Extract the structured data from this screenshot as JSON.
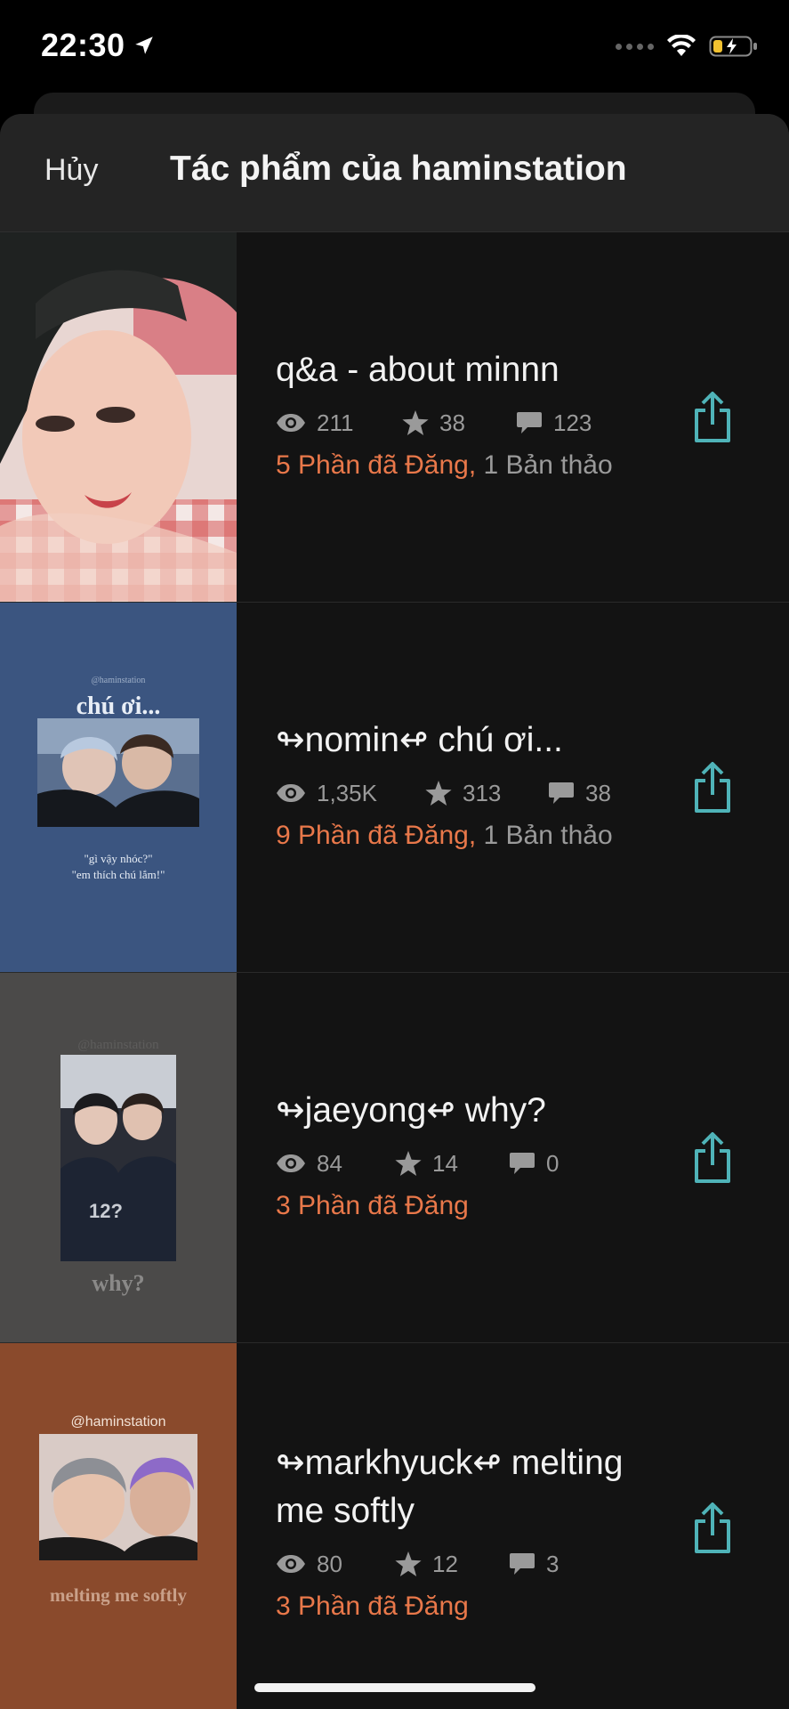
{
  "status_bar": {
    "time": "22:30"
  },
  "header": {
    "cancel_label": "Hủy",
    "title": "Tác phẩm của haminstation"
  },
  "stories": [
    {
      "title": "q&a - about minnn",
      "views": "211",
      "votes": "38",
      "comments": "123",
      "published": "5 Phần đã Đăng,",
      "drafts": "1 Bản thảo",
      "cover": {}
    },
    {
      "title": "↬nomin↫ chú ơi...",
      "views": "1,35K",
      "votes": "313",
      "comments": "38",
      "published": "9 Phần đã Đăng,",
      "drafts": "1 Bản thảo",
      "cover": {
        "watermark": "@haminstation",
        "heading": "chú ơi...",
        "line1": "\"gì vậy nhóc?\"",
        "line2": "\"em thích chú lắm!\""
      }
    },
    {
      "title": "↬jaeyong↫ why?",
      "views": "84",
      "votes": "14",
      "comments": "0",
      "published": "3 Phần đã Đăng",
      "drafts": "",
      "cover": {
        "watermark": "@haminstation",
        "heading": "why?"
      }
    },
    {
      "title": "↬markhyuck↫ melting me softly",
      "views": "80",
      "votes": "12",
      "comments": "3",
      "published": "3 Phần đã Đăng",
      "drafts": "",
      "cover": {
        "watermark": "@haminstation",
        "heading": "melting me softly"
      }
    }
  ],
  "colors": {
    "accent_orange": "#e9784a",
    "share_teal": "#4fb3b8",
    "background": "#131313",
    "header_bg": "#242424"
  },
  "icons": {
    "views": "eye-icon",
    "votes": "star-icon",
    "comments": "comment-icon",
    "share": "share-icon"
  }
}
